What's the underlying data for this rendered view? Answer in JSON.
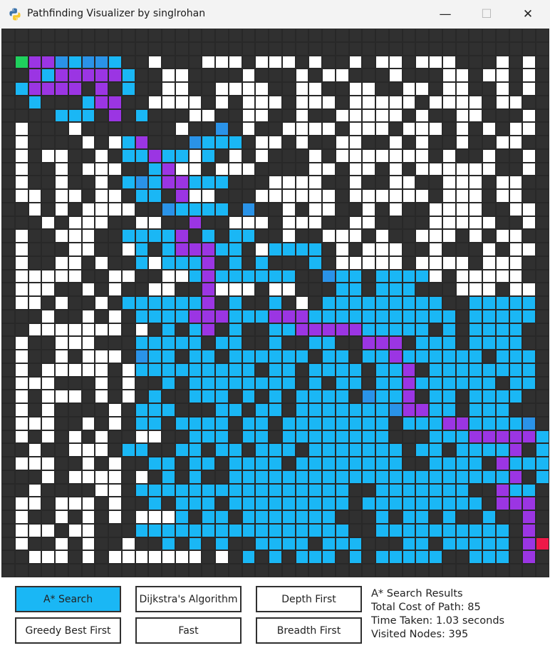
{
  "window": {
    "title": "Pathfinding Visualizer by singlrohan",
    "controls": {
      "minimize": "—",
      "maximize": "☐",
      "close": "✕"
    }
  },
  "colors": {
    "wall": "#303030",
    "open": "#ffffff",
    "visited": "#1ab7f5",
    "frontier": "#2a93e8",
    "path": "#9b35e3",
    "start": "#1fd05d",
    "end": "#ef1848",
    "grid_line": "#282828",
    "active_button": "#1ab7f5"
  },
  "legend_codes": {
    "#": "wall",
    ".": "open",
    "v": "visited",
    "f": "frontier",
    "p": "path",
    "S": "start",
    "E": "end"
  },
  "grid": {
    "cols": 41,
    "rows": 41,
    "cells": [
      "#########################################",
      "#########################################",
      "#Sppfvffv##.###...#...#.##.#..#...###.#.#",
      "##pvpppppv##..####.###.#..###.###..#..#.#",
      "#vpppp#p#v##..##....##..##..##..#..##.#.#",
      "##v###vpp##....#.#...#...#.....#....#..##",
      "####vvv#p#v###..##..##.##.....#.##..###.#",
      "#.###.#######.##f#.##....#...#...#.#.#..#",
      "#.####.#.vp###fvvv#..#.##..##.#.##.##..##",
      "#.#..##.#vvpvv.v#.#.###.#.......#.##.##.#",
      "#.##.#...##vp..#...####..#..#.#......##.#",
      "#.##.##.#vfvppvvv###....##.##..##...#..##",
      "#..#..#..#vv#p..###......#......#...#..##",
      "##.#.#....##fvvvv#f##.#..##.#.##....##..#",
      "###.#...##..##p##...#...##..####.....##.#",
      "#.##...##vvvvp#v#vv##.##...#.##...#.#..##",
      "#.###..##.v#vpppvv#.vvvv#.#...##.###.#..#",
      "#.##..#.##v.vvvp#v#v###v#.....#....#...##",
      "#.....##..##..vpvvvvvv##fvv#vvvv.#.....##",
      "#...##.#.##..##p...#..###vv#vvv###...#..#",
      "#..#.##.#vvvvvvp#v##v#.#vvvvvvvvv##vvvvv#",
      "###.##.#.#vvvvpppvvvpppvvvvvvvvvvv#vvvvv#",
      "##.......#.#v#vp#v##vvpppppvvvvv#v#vvvv##",
      "#.##...###vvvvv#vv##v##vv##ppp#vvv#vvvv##",
      "#.##.#...#fvv#vv#vvvvvv#vv#vvpvvvvvv#vvv#",
      "#.#.....#.vvvvvvvvv#vv#vvvv#vvp#vvvvvvvv#",
      "#...###.#.##v#vvvvvvvv#v#vv#vvpvvvvvv#vv#",
      "#.#...#.#.#v##vvv#v#v#vvvv#fvvp#vv#vvvv##",
      "#.#.####.#vvv###vv#vv#vvvvvvvfppvv#vvv###",
      "#...##.#.#vv#vvvv#vv#vvvvvvvv#vvvppvvvvf#",
      "#.#.#.#.##..##vvv#vv#vvvvvvvv###vvvpppppv",
      "##.##...#vv##vv#vv#vvv#vvvvvvv#vv#vvvvp#v",
      "#...##.#.##vv#vv#vvvv#vvvvvvvv##vvvv#pvvv",
      "###.#....#.#v#v##vvvvvvvvvvvvvvvvvvvvvp#v",
      "##.####..#vvvvvvvvvvvvvvvv##vvvvvvv##pvv#",
      "#..#...#.##v#vvv#vvvvvvvvv#vvvvvvvvv#ppp#",
      "#.##.#.#.#...v#vv#vvvvvvv###v#vv#v##v##p#",
      "#...#..###vvvvvvvvvvvvvvvv##vvvvvvvvvv#p#",
      "#.##.#.##.##v#v#v##vvvv#vvv###vv#vvvvv#pE",
      "##...#.#.......#.#v#v#vvv#v#vvvvv##vvv#p#",
      "#########################################"
    ]
  },
  "buttons": [
    {
      "label": "A* Search",
      "active": true
    },
    {
      "label": "Dijkstra's Algorithm",
      "active": false
    },
    {
      "label": "Depth First",
      "active": false
    },
    {
      "label": "Greedy Best First",
      "active": false
    },
    {
      "label": "Fast",
      "active": false
    },
    {
      "label": "Breadth First",
      "active": false
    }
  ],
  "results": {
    "heading": "A* Search Results",
    "cost": "Total Cost of Path: 85",
    "time": "Time Taken: 1.03 seconds",
    "visited": "Visited Nodes: 395"
  }
}
